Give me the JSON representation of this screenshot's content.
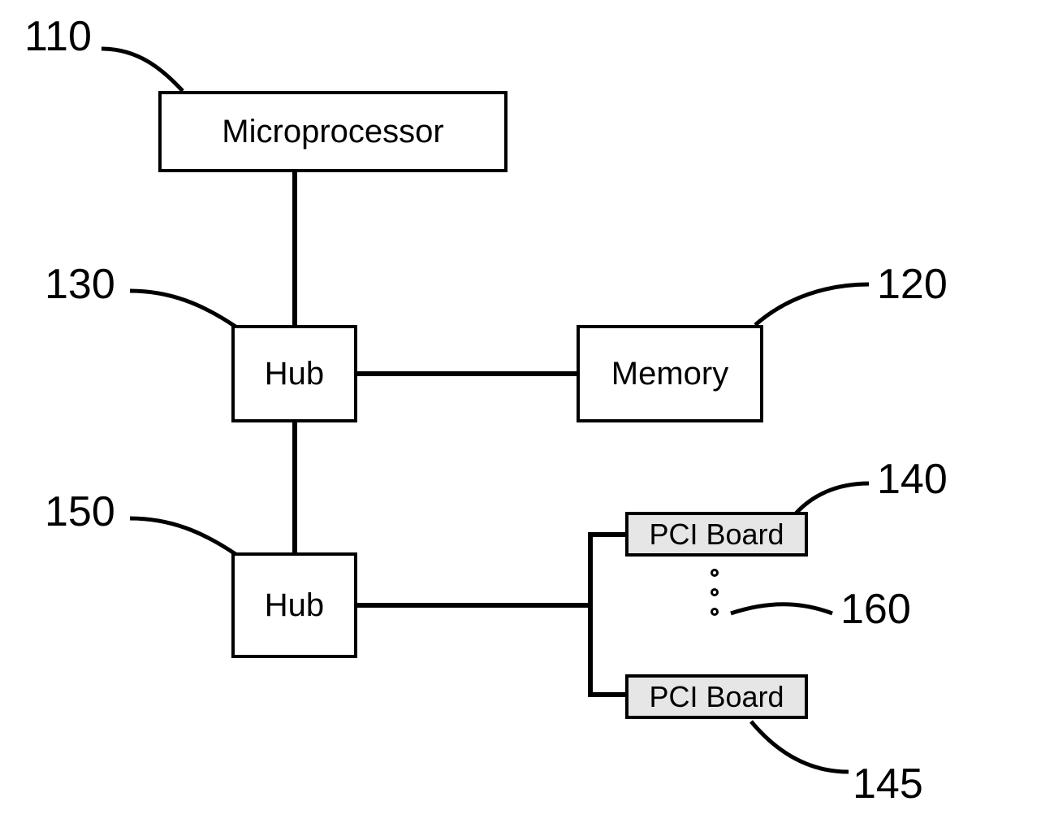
{
  "labels": {
    "l110": "110",
    "l120": "120",
    "l130": "130",
    "l140": "140",
    "l145": "145",
    "l150": "150",
    "l160": "160"
  },
  "boxes": {
    "microprocessor": "Microprocessor",
    "hub1": "Hub",
    "memory": "Memory",
    "hub2": "Hub",
    "pci1": "PCI Board",
    "pci2": "PCI Board"
  }
}
